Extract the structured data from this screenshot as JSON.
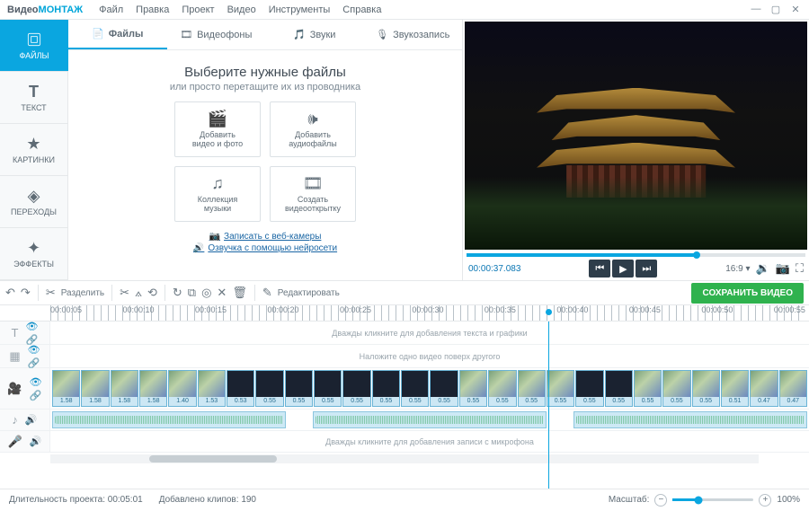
{
  "app": {
    "name_a": "Видео",
    "name_b": "МОНТАЖ"
  },
  "menu": [
    "Файл",
    "Правка",
    "Проект",
    "Видео",
    "Инструменты",
    "Справка"
  ],
  "sidebar": [
    {
      "label": "ФАЙЛЫ",
      "icon": "files-icon",
      "active": true
    },
    {
      "label": "ТЕКСТ",
      "icon": "text-icon"
    },
    {
      "label": "КАРТИНКИ",
      "icon": "star-icon"
    },
    {
      "label": "ПЕРЕХОДЫ",
      "icon": "transition-icon"
    },
    {
      "label": "ЭФФЕКТЫ",
      "icon": "wand-icon"
    }
  ],
  "tabs": [
    {
      "label": "Файлы",
      "icon": "file-icon",
      "active": true
    },
    {
      "label": "Видеофоны",
      "icon": "videobg-icon"
    },
    {
      "label": "Звуки",
      "icon": "sound-icon"
    },
    {
      "label": "Звукозапись",
      "icon": "mic-icon"
    }
  ],
  "mid": {
    "title": "Выберите нужные файлы",
    "sub": "или просто перетащите их из проводника",
    "cards": [
      {
        "l1": "Добавить",
        "l2": "видео и фото"
      },
      {
        "l1": "Добавить",
        "l2": "аудиофайлы"
      },
      {
        "l1": "Коллекция",
        "l2": "музыки"
      },
      {
        "l1": "Создать",
        "l2": "видеооткрытку"
      }
    ],
    "links": [
      "Записать с веб-камеры",
      "Озвучка с помощью нейросети"
    ]
  },
  "preview": {
    "time": "00:00:37.083",
    "ratio": "16:9"
  },
  "toolbar": {
    "split": "Разделить",
    "edit": "Редактировать",
    "save": "СОХРАНИТЬ ВИДЕО"
  },
  "ruler": [
    "00:00:05",
    "00:00:10",
    "00:00:15",
    "00:00:20",
    "00:00:25",
    "00:00:30",
    "00:00:35",
    "00:00:40",
    "00:00:45",
    "00:00:50",
    "00:00:55"
  ],
  "hints": {
    "text": "Дважды кликните для добавления текста и графики",
    "overlay": "Наложите одно видео поверх другого",
    "mic": "Дважды кликните для добавления записи с микрофона"
  },
  "clips": [
    {
      "d": "1.58"
    },
    {
      "d": "1.58"
    },
    {
      "d": "1.58"
    },
    {
      "d": "1.58"
    },
    {
      "d": "1.40"
    },
    {
      "d": "1.53"
    },
    {
      "d": "0.53"
    },
    {
      "d": "0.55"
    },
    {
      "d": "0.55"
    },
    {
      "d": "0.55"
    },
    {
      "d": "0.55"
    },
    {
      "d": "0.55"
    },
    {
      "d": "0.55"
    },
    {
      "d": "0.55"
    },
    {
      "d": "0.55"
    },
    {
      "d": "0.55"
    },
    {
      "d": "0.55"
    },
    {
      "d": "0.55"
    },
    {
      "d": "0.55"
    },
    {
      "d": "0.55"
    },
    {
      "d": "0.55"
    },
    {
      "d": "0.55"
    },
    {
      "d": "0.55"
    },
    {
      "d": "0.51"
    },
    {
      "d": "0.47"
    },
    {
      "d": "0.47"
    }
  ],
  "status": {
    "dur_lbl": "Длительность проекта:",
    "dur_val": "00:05:01",
    "clips_lbl": "Добавлено клипов:",
    "clips_val": "190",
    "zoom_lbl": "Масштаб:",
    "zoom_val": "100%"
  }
}
